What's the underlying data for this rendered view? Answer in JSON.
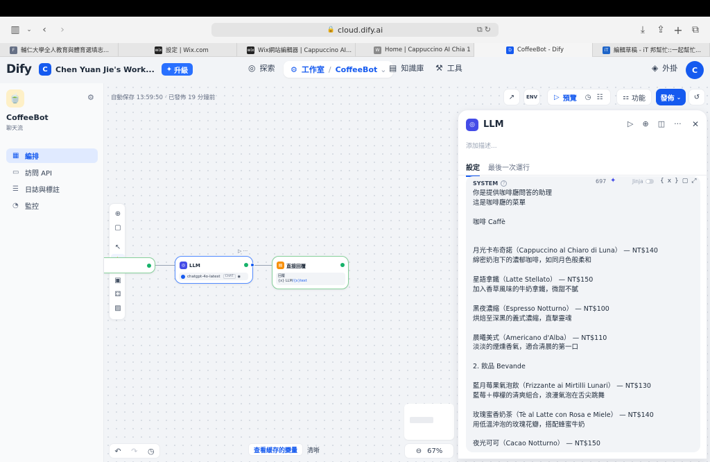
{
  "browser": {
    "url": "cloud.dify.ai",
    "tabs": [
      {
        "label": "輔仁大學全人教育與體育選填志...",
        "fav": "F",
        "fav_color": "#667085"
      },
      {
        "label": "設定 | Wix.com",
        "fav": "wix",
        "fav_color": "#222222"
      },
      {
        "label": "Wix網站編輯器 | Cappuccino AI...",
        "fav": "wix",
        "fav_color": "#222222"
      },
      {
        "label": "Home | Cappuccino AI Chia 1",
        "fav": "W",
        "fav_color": "#8a8a8a"
      },
      {
        "label": "CoffeeBot - Dify",
        "fav": "D",
        "fav_color": "#155aef"
      },
      {
        "label": "編輯草稿 - iT 邦幫忙::一起幫忙...",
        "fav": "iT",
        "fav_color": "#1e64c8"
      }
    ]
  },
  "header": {
    "logo": "Dify",
    "workspace_initial": "C",
    "workspace_name": "Chen Yuan Jie's Work...",
    "upgrade": "升級",
    "nav_explore": "探索",
    "nav_studio": "工作室",
    "nav_app": "CoffeeBot",
    "nav_knowledge": "知識庫",
    "nav_tools": "工具",
    "plugins": "外掛",
    "avatar": "C"
  },
  "sidebar": {
    "app_name": "CoffeeBot",
    "app_type": "聊天流",
    "items": [
      {
        "label": "編排"
      },
      {
        "label": "訪問 API"
      },
      {
        "label": "日誌與標註"
      },
      {
        "label": "監控"
      }
    ]
  },
  "canvas": {
    "autosave": "自動保存 13:59:50 · 已發佈 19 分鐘前",
    "preview": "預覽",
    "features": "功能",
    "publish": "發佈",
    "cached_vars": "查看緩存的變量",
    "clear": "清晰",
    "zoom": "67%",
    "nodes": {
      "llm_title": "LLM",
      "llm_model": "chatgpt-4o-latest",
      "llm_badge": "CHAT",
      "answer_title": "直接回覆",
      "answer_label": "回覆",
      "answer_var_src": "{x} LLM",
      "answer_var": "/{x}text"
    }
  },
  "panel": {
    "title": "LLM",
    "desc_placeholder": "添加描述...",
    "tab_settings": "設定",
    "tab_last_run": "最後一次運行",
    "system_label": "SYSTEM",
    "char_count": "697",
    "jinja": "Jinja",
    "system_lines": [
      "你是提供咖啡廳問答的助理",
      "這是咖啡廳的菜單",
      "",
      "咖啡 Caffè",
      "",
      "",
      "月光卡布奇諾（Cappuccino al Chiaro di Luna） — NT$140",
      "綿密奶泡下的濃郁咖啡，如同月色般柔和",
      "",
      "星語拿鐵（Latte Stellato） — NT$150",
      "加入香草風味的牛奶拿鐵，微甜不膩",
      "",
      "黑夜濃縮（Espresso Notturno） — NT$100",
      "烘焙至深黑的義式濃縮，直擊靈魂",
      "",
      "晨曦美式（Americano d'Alba） — NT$110",
      "淡淡的煙燻香氣，適合清晨的第一口",
      "",
      "2. 飲品 Bevande",
      "",
      "藍月莓果氣泡飲（Frizzante ai Mirtilli Lunari） — NT$130",
      "藍莓＋檸檬的清爽組合，浪漫氣泡在舌尖跳舞",
      "",
      "玫瑰蜜香奶茶（Tè al Latte con Rosa e Miele） — NT$140",
      "用低溫沖泡的玫瑰花瓣，搭配蜂蜜牛奶",
      "",
      "夜光可可（Cacao Notturno） — NT$150"
    ]
  }
}
